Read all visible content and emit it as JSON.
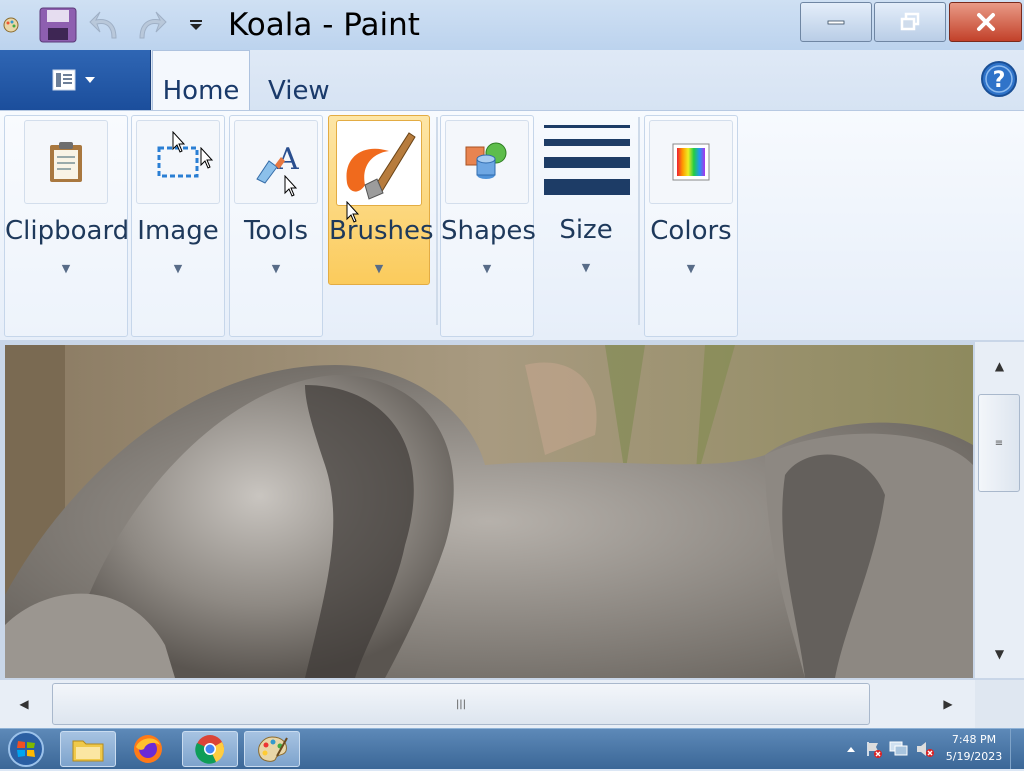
{
  "window": {
    "title": "Koala - Paint"
  },
  "quick_access": {
    "icons": [
      "app-icon",
      "save-icon",
      "undo-icon",
      "redo-icon",
      "customize-dropdown-icon"
    ]
  },
  "tabs": [
    {
      "label": "Home",
      "active": true
    },
    {
      "label": "View",
      "active": false
    }
  ],
  "ribbon": {
    "groups": [
      {
        "label": "Clipboard",
        "icon": "clipboard-icon"
      },
      {
        "label": "Image",
        "icon": "select-icon"
      },
      {
        "label": "Tools",
        "icon": "tools-icon"
      },
      {
        "label": "Brushes",
        "icon": "brush-icon",
        "active": true
      },
      {
        "label": "Shapes",
        "icon": "shapes-icon"
      },
      {
        "label": "Size",
        "icon": "size-icon"
      },
      {
        "label": "Colors",
        "icon": "colors-icon"
      }
    ]
  },
  "canvas": {
    "image": "koala photo"
  },
  "taskbar": {
    "items": [
      "start-button",
      "file-explorer",
      "firefox",
      "chrome",
      "paint"
    ],
    "clock_time": "7:48 PM",
    "clock_date": "5/19/2023"
  },
  "colors": {
    "accent": "#1b4e9c",
    "ribbon_active": "#fbcb5c",
    "close_red": "#c2412a"
  }
}
